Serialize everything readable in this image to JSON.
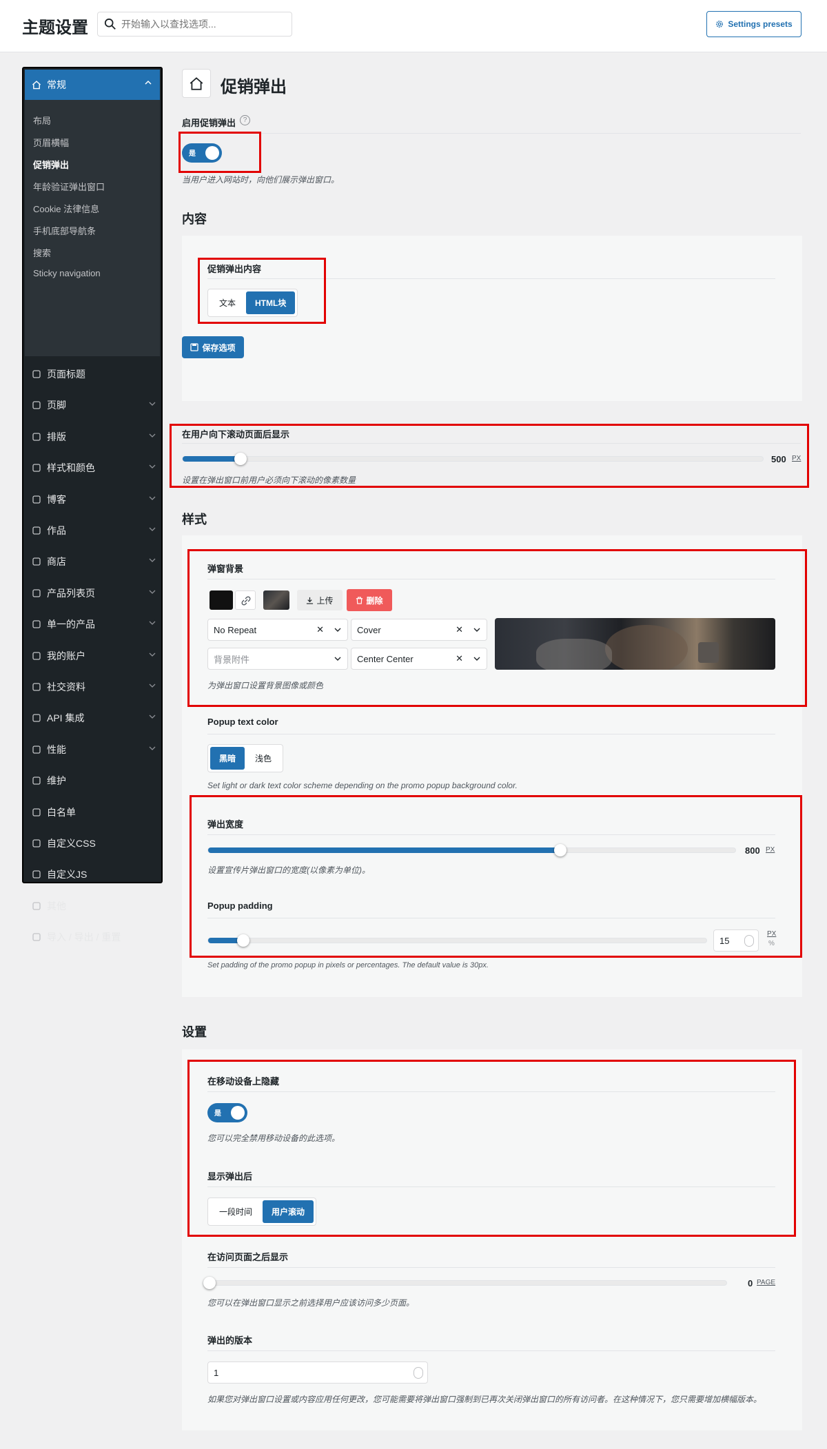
{
  "header": {
    "app_title": "主题设置",
    "search_placeholder": "开始输入以查找选项...",
    "presets_label": "Settings presets"
  },
  "sidebar": {
    "active": {
      "label": "常规",
      "icon": "home-icon"
    },
    "subitems": [
      "布局",
      "页眉横幅",
      "促销弹出",
      "年龄验证弹出窗口",
      "Cookie 法律信息",
      "手机底部导航条",
      "搜索",
      "Sticky navigation"
    ],
    "current_subitem": "促销弹出",
    "items": [
      {
        "label": "页面标题",
        "icon": "page-title-icon",
        "expandable": false
      },
      {
        "label": "页脚",
        "icon": "footer-icon",
        "expandable": true
      },
      {
        "label": "排版",
        "icon": "typography-icon",
        "expandable": true
      },
      {
        "label": "样式和颜色",
        "icon": "brush-icon",
        "expandable": true
      },
      {
        "label": "博客",
        "icon": "blog-icon",
        "expandable": true
      },
      {
        "label": "作品",
        "icon": "briefcase-icon",
        "expandable": true
      },
      {
        "label": "商店",
        "icon": "cart-icon",
        "expandable": true
      },
      {
        "label": "产品列表页",
        "icon": "archive-icon",
        "expandable": true
      },
      {
        "label": "单一的产品",
        "icon": "bag-icon",
        "expandable": true
      },
      {
        "label": "我的账户",
        "icon": "account-icon",
        "expandable": true
      },
      {
        "label": "社交资料",
        "icon": "users-icon",
        "expandable": true
      },
      {
        "label": "API 集成",
        "icon": "gear-icon",
        "expandable": true
      },
      {
        "label": "性能",
        "icon": "gauge-icon",
        "expandable": true
      },
      {
        "label": "维护",
        "icon": "wrench-icon",
        "expandable": false
      },
      {
        "label": "白名单",
        "icon": "tag-icon",
        "expandable": false
      },
      {
        "label": "自定义CSS",
        "icon": "css-file-icon",
        "expandable": false
      },
      {
        "label": "自定义JS",
        "icon": "js-file-icon",
        "expandable": false
      },
      {
        "label": "其他",
        "icon": "other-icon",
        "expandable": false
      },
      {
        "label": "导入 / 导出 / 重置",
        "icon": "refresh-icon",
        "expandable": false
      }
    ]
  },
  "page": {
    "title": "促销弹出",
    "enable": {
      "label": "启用促销弹出",
      "toggle_text": "是",
      "desc": "当用户进入网站时，向他们展示弹出窗口。"
    },
    "content": {
      "heading": "内容",
      "popup_content_label": "促销弹出内容",
      "options": [
        "文本",
        "HTML块"
      ],
      "selected": "HTML块",
      "save_label": "保存选项"
    },
    "scroll": {
      "label": "在用户向下滚动页面后显示",
      "value": 500,
      "max": 5000,
      "unit": "PX",
      "desc": "设置在弹出窗口前用户必须向下滚动的像素数量"
    },
    "style": {
      "heading": "样式",
      "bg": {
        "label": "弹窗背景",
        "upload_label": "上传",
        "delete_label": "删除",
        "repeat": "No Repeat",
        "size": "Cover",
        "attachment_placeholder": "背景附件",
        "position": "Center Center",
        "desc": "为弹出窗口设置背景图像或颜色"
      },
      "text_color": {
        "label": "Popup text color",
        "options": [
          "黑暗",
          "浅色"
        ],
        "selected": "黑暗",
        "desc": "Set light or dark text color scheme depending on the promo popup background color."
      },
      "width": {
        "label": "弹出宽度",
        "value": 800,
        "max": 1200,
        "unit": "PX",
        "desc": "设置宣传片弹出窗口的宽度(以像素为单位)。"
      },
      "padding": {
        "label": "Popup padding",
        "value": "15",
        "fraction": 0.07,
        "unit_px": "PX",
        "unit_pct": "%",
        "desc": "Set padding of the promo popup in pixels or percentages. The default value is 30px."
      }
    },
    "settings": {
      "heading": "设置",
      "hide_mobile": {
        "label": "在移动设备上隐藏",
        "toggle_text": "是",
        "desc": "您可以完全禁用移动设备的此选项。"
      },
      "show_after": {
        "label": "显示弹出后",
        "options": [
          "一段时间",
          "用户滚动"
        ],
        "selected": "用户滚动"
      },
      "pages": {
        "label": "在访问页面之后显示",
        "value": 0,
        "unit": "PAGE",
        "desc": "您可以在弹出窗口显示之前选择用户应该访问多少页面。"
      },
      "version": {
        "label": "弹出的版本",
        "value": "1",
        "desc": "如果您对弹出窗口设置或内容应用任何更改，您可能需要将弹出窗口强制到已再次关闭弹出窗口的所有访问者。在这种情况下，您只需要增加横幅版本。"
      }
    }
  },
  "colors": {
    "accent": "#2271b1",
    "sidebar_bg": "#1d2327",
    "sub_bg": "#2c3338",
    "danger": "#f05a5a",
    "highlight": "#e20000"
  }
}
